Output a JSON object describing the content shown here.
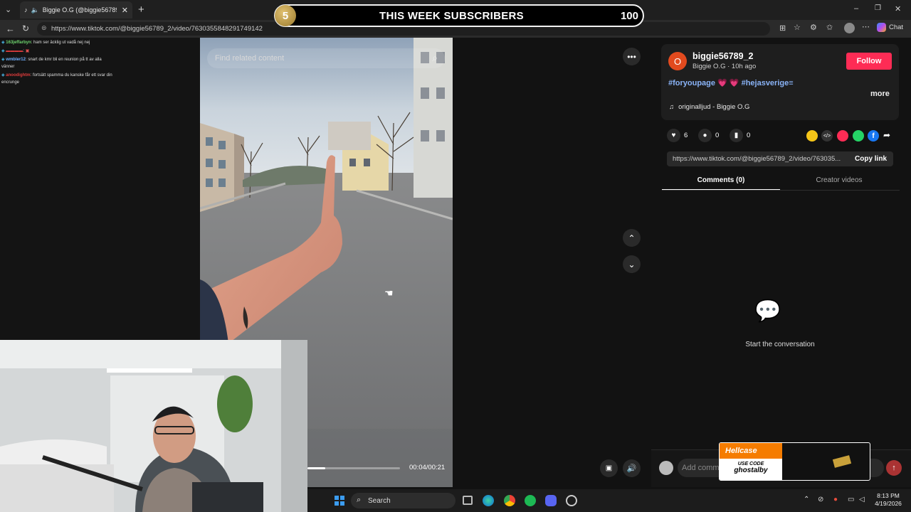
{
  "browser": {
    "tab_title": "Biggie O.G (@biggie56789_2)",
    "url": "https://www.tiktok.com/@biggie56789_2/video/7630355848291749142",
    "chat_button": "Chat"
  },
  "overlay": {
    "sub_goal_number": "5",
    "sub_goal_title": "THIS WEEK SUBSCRIBERS",
    "sub_goal_count": "100"
  },
  "stream_chat": [
    {
      "user": "163jeffarbyn",
      "text": ": ham ser äcklig ut vadå nej nej"
    },
    {
      "user": "",
      "text": ":"
    },
    {
      "user": "wmbler12",
      "text": ": snart de kmr bli en reunion på tt av alla vänner"
    },
    {
      "user": "anoodightm",
      "text": ": fortsätt spamma du kanske får ett svar din encrunge"
    }
  ],
  "video": {
    "search_placeholder": "Find related content",
    "time": "00:04/00:21",
    "progress": 0.19
  },
  "post": {
    "avatar_letter": "O",
    "username": "biggie56789_2",
    "meta": "Biggie O.G · 10h ago",
    "follow_label": "Follow",
    "hashtags": "#foryoupage 💗 💗  #hejasverige≡",
    "more_label": "more",
    "sound": "originalljud - Biggie O.G",
    "likes": "6",
    "comments": "0",
    "saves": "0",
    "link": "https://www.tiktok.com/@biggie56789_2/video/763035...",
    "copy_link_label": "Copy link",
    "tab_comments": "Comments (0)",
    "tab_creator": "Creator videos",
    "empty_text": "Start the conversation",
    "add_comment_placeholder": "Add comm"
  },
  "ad": {
    "brand": "Hellcase",
    "use_code": "USE CODE",
    "code": "ghostalby"
  },
  "taskbar": {
    "search_label": "Search",
    "time": "8:13 PM",
    "date": "4/19/2026"
  },
  "colors": {
    "follow": "#fe2c55",
    "hashtag": "#8ab4f8",
    "sub_badge": "#c9a24a"
  }
}
